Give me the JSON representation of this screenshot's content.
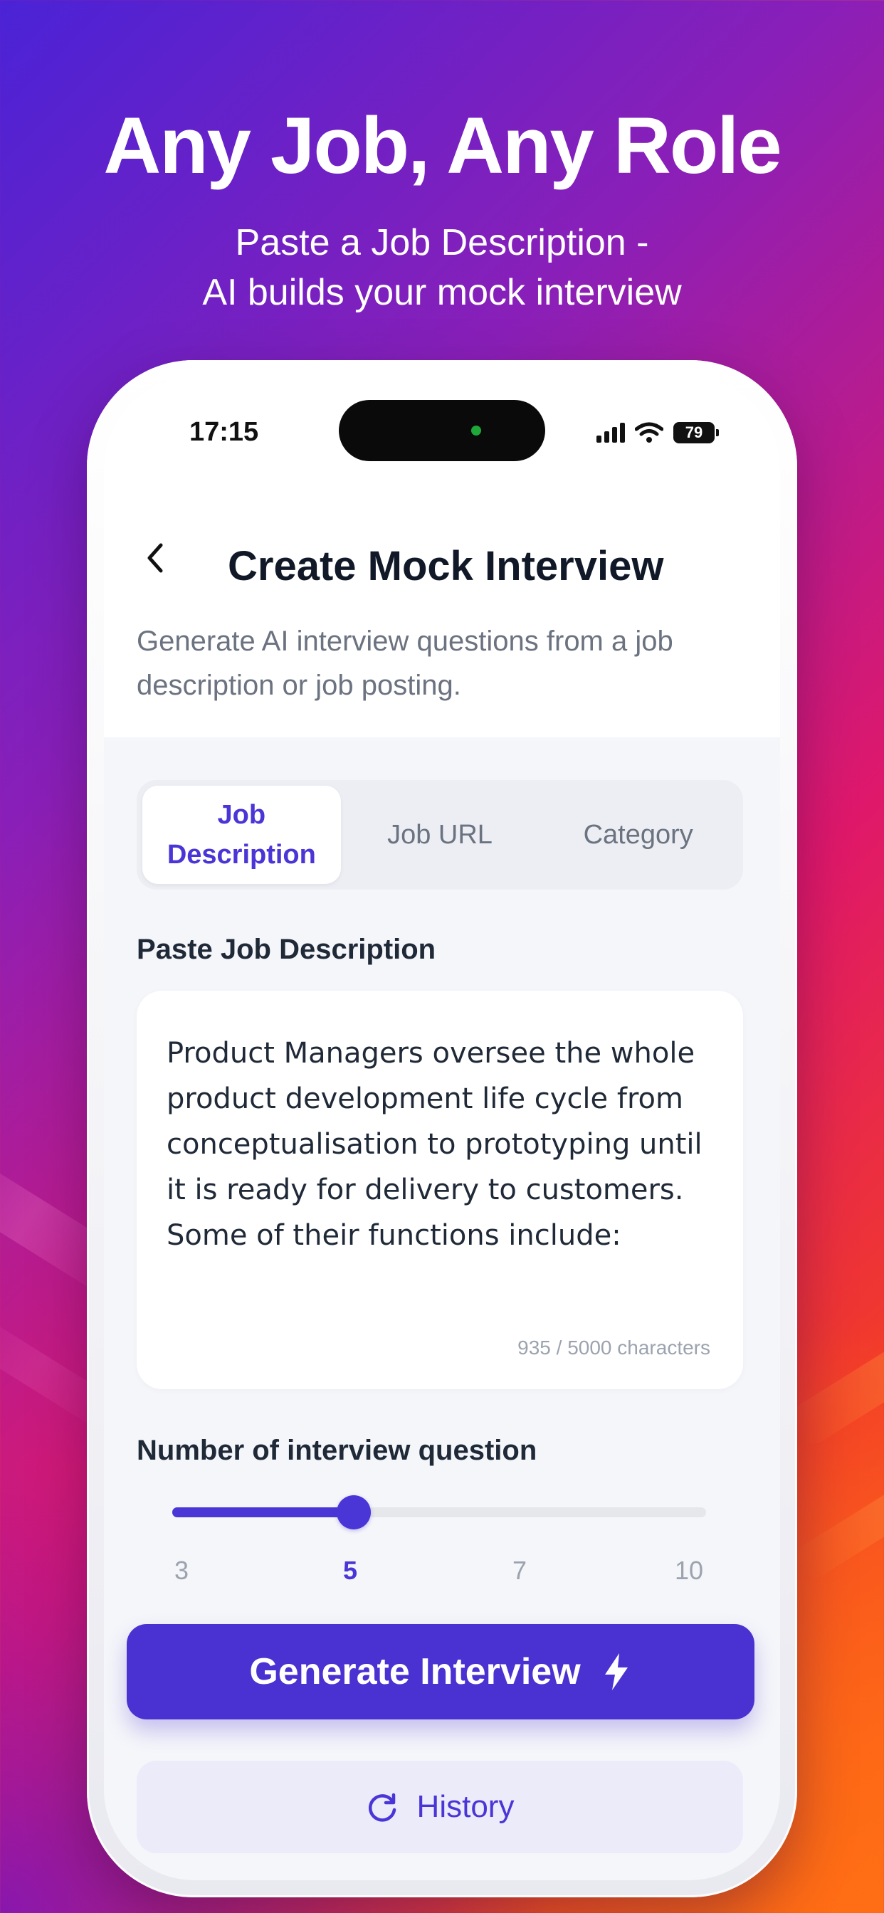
{
  "promo": {
    "headline": "Any Job, Any Role",
    "subline_1": "Paste a Job Description -",
    "subline_2": "AI builds your mock interview"
  },
  "status_bar": {
    "time": "17:15",
    "battery": "79"
  },
  "header": {
    "title": "Create Mock Interview",
    "description": "Generate AI interview questions from a job description or job posting."
  },
  "tabs": [
    {
      "label_line1": "Job",
      "label_line2": "Description",
      "active": true
    },
    {
      "label": "Job URL",
      "active": false
    },
    {
      "label": "Category",
      "active": false
    }
  ],
  "job_description": {
    "label": "Paste Job Description",
    "value": "Product Managers oversee the whole product development life cycle from conceptualisation to prototyping until it is ready for delivery to customers. Some of their functions include:",
    "char_count": "935 / 5000 characters"
  },
  "questions": {
    "label": "Number of interview question",
    "options": [
      "3",
      "5",
      "7",
      "10"
    ],
    "selected": "5",
    "fill_fraction": 0.34
  },
  "actions": {
    "generate_label": "Generate Interview",
    "history_label": "History"
  },
  "colors": {
    "accent": "#4a35d6",
    "button": "#4a31d2",
    "history_bg": "#ebebfa"
  },
  "icons": [
    "back-chevron-icon",
    "lightning-bolt-icon",
    "refresh-icon",
    "signal-icon",
    "wifi-icon",
    "battery-icon"
  ]
}
